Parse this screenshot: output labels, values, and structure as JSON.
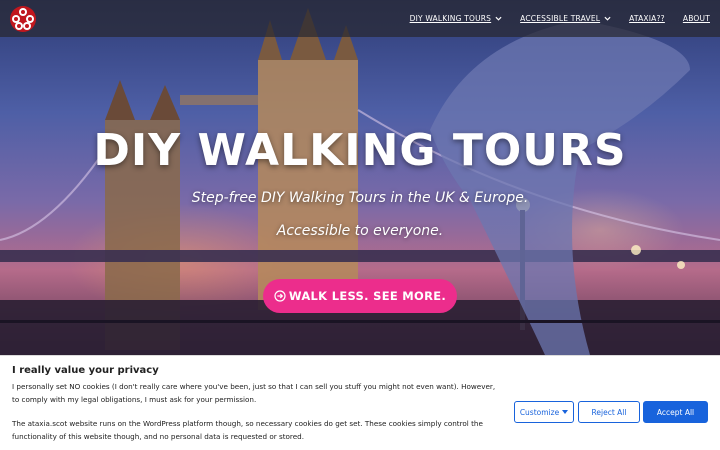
{
  "header": {
    "logo_icon": "ataxia-logo-icon",
    "nav": [
      {
        "label": "DIY WALKING TOURS",
        "has_dropdown": true
      },
      {
        "label": "ACCESSIBLE TRAVEL",
        "has_dropdown": true
      },
      {
        "label": "ATAXIA??",
        "has_dropdown": false
      },
      {
        "label": "ABOUT",
        "has_dropdown": false
      }
    ]
  },
  "hero": {
    "title": "DIY WALKING TOURS",
    "subtitle_1": "Step-free DIY Walking Tours in the UK & Europe.",
    "subtitle_2": "Accessible to everyone.",
    "cta_label": "WALK LESS. SEE MORE.",
    "cta_icon": "arrow-circle-right-icon",
    "cta_color": "#ec2d8c"
  },
  "cookie_banner": {
    "title": "I really value your privacy",
    "text_1": "I personally set NO cookies (I don't really care where you've been, just so that I can sell you stuff you might not even want). However, to comply with my legal obligations, I must ask for your permission.",
    "text_2": "The ataxia.scot website runs on the WordPress platform though, so necessary cookies do get set. These cookies simply control the functionality of this website though, and no personal data is requested or stored.",
    "customize_label": "Customize",
    "reject_label": "Reject All",
    "accept_label": "Accept All",
    "accent_color": "#1863dc"
  }
}
